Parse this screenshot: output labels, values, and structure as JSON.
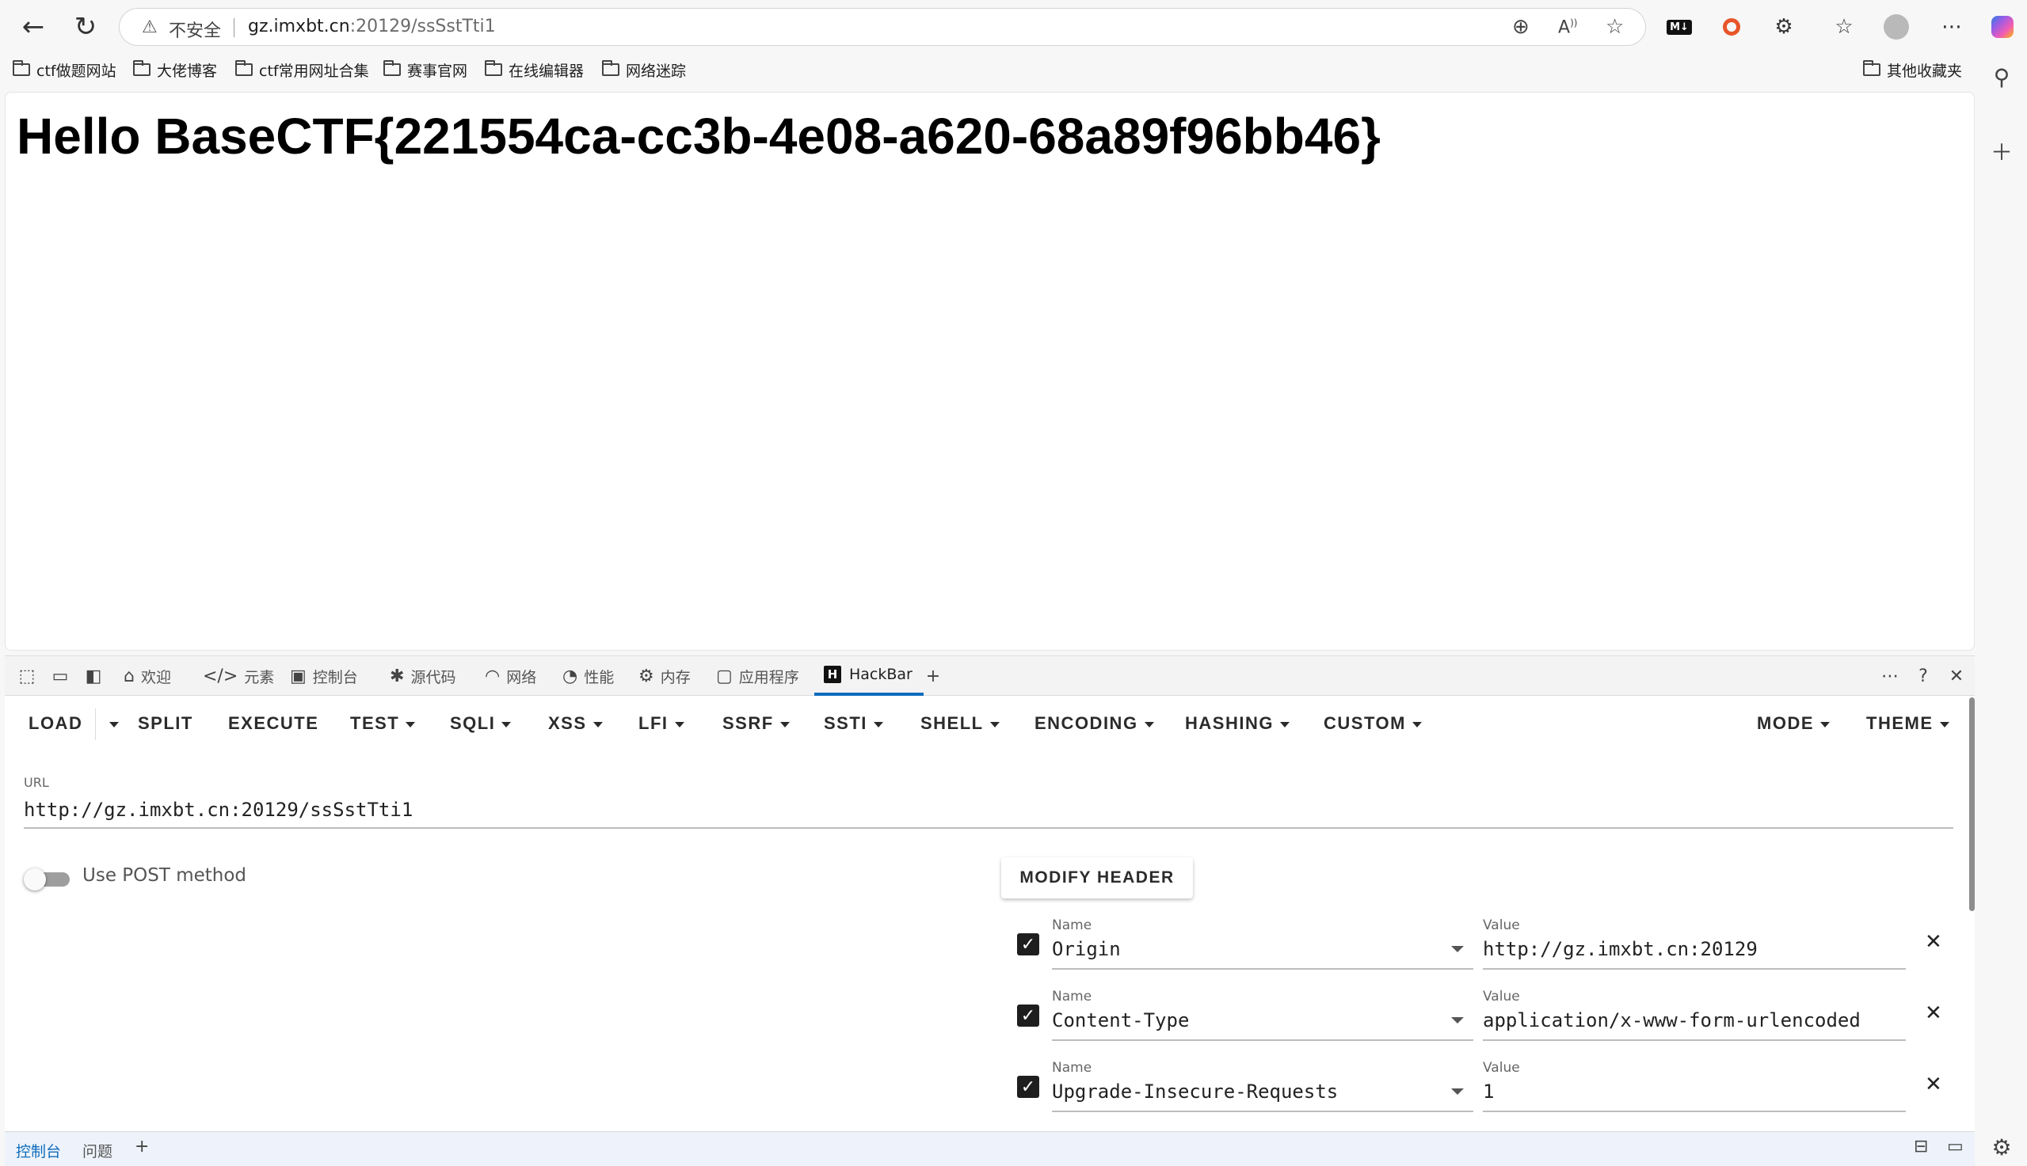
{
  "browser": {
    "security_label": "不安全",
    "url_host": "gz.imxbt.cn",
    "url_rest": ":20129/ssSstTti1",
    "icons": [
      "back-icon",
      "refresh-icon",
      "warning-icon",
      "zoom-icon",
      "read-aloud-icon",
      "favorite-star-icon",
      "markdown-icon",
      "record-icon",
      "extensions-icon",
      "favorites-icon",
      "profile-icon",
      "more-icon",
      "copilot-icon"
    ]
  },
  "bookmarks": {
    "items": [
      "ctf做题网站",
      "大佬博客",
      "ctf常用网址合集",
      "赛事官网",
      "在线编辑器",
      "网络迷踪"
    ],
    "other": "其他收藏夹"
  },
  "page": {
    "heading": "Hello BaseCTF{221554ca-cc3b-4e08-a620-68a89f96bb46}"
  },
  "devtools": {
    "tabs": [
      "欢迎",
      "元素",
      "控制台",
      "源代码",
      "网络",
      "性能",
      "内存",
      "应用程序",
      "HackBar"
    ],
    "active_tab": "HackBar",
    "drawer_tabs": [
      "控制台",
      "问题"
    ]
  },
  "hackbar": {
    "toolbar": [
      "LOAD",
      "SPLIT",
      "EXECUTE",
      "TEST",
      "SQLI",
      "XSS",
      "LFI",
      "SSRF",
      "SSTI",
      "SHELL",
      "ENCODING",
      "HASHING",
      "CUSTOM",
      "MODE",
      "THEME"
    ],
    "url_label": "URL",
    "url_value": "http://gz.imxbt.cn:20129/ssSstTti1",
    "post_label": "Use POST method",
    "post_enabled": false,
    "modify_header": "MODIFY HEADER",
    "name_label": "Name",
    "value_label": "Value",
    "headers": [
      {
        "name": "Origin",
        "value": "http://gz.imxbt.cn:20129",
        "checked": true
      },
      {
        "name": "Content-Type",
        "value": "application/x-www-form-urlencoded",
        "checked": true
      },
      {
        "name": "Upgrade-Insecure-Requests",
        "value": "1",
        "checked": true
      }
    ]
  },
  "colors": {
    "accent": "#0f6cbd",
    "checkbox": "#1e1e1e"
  }
}
